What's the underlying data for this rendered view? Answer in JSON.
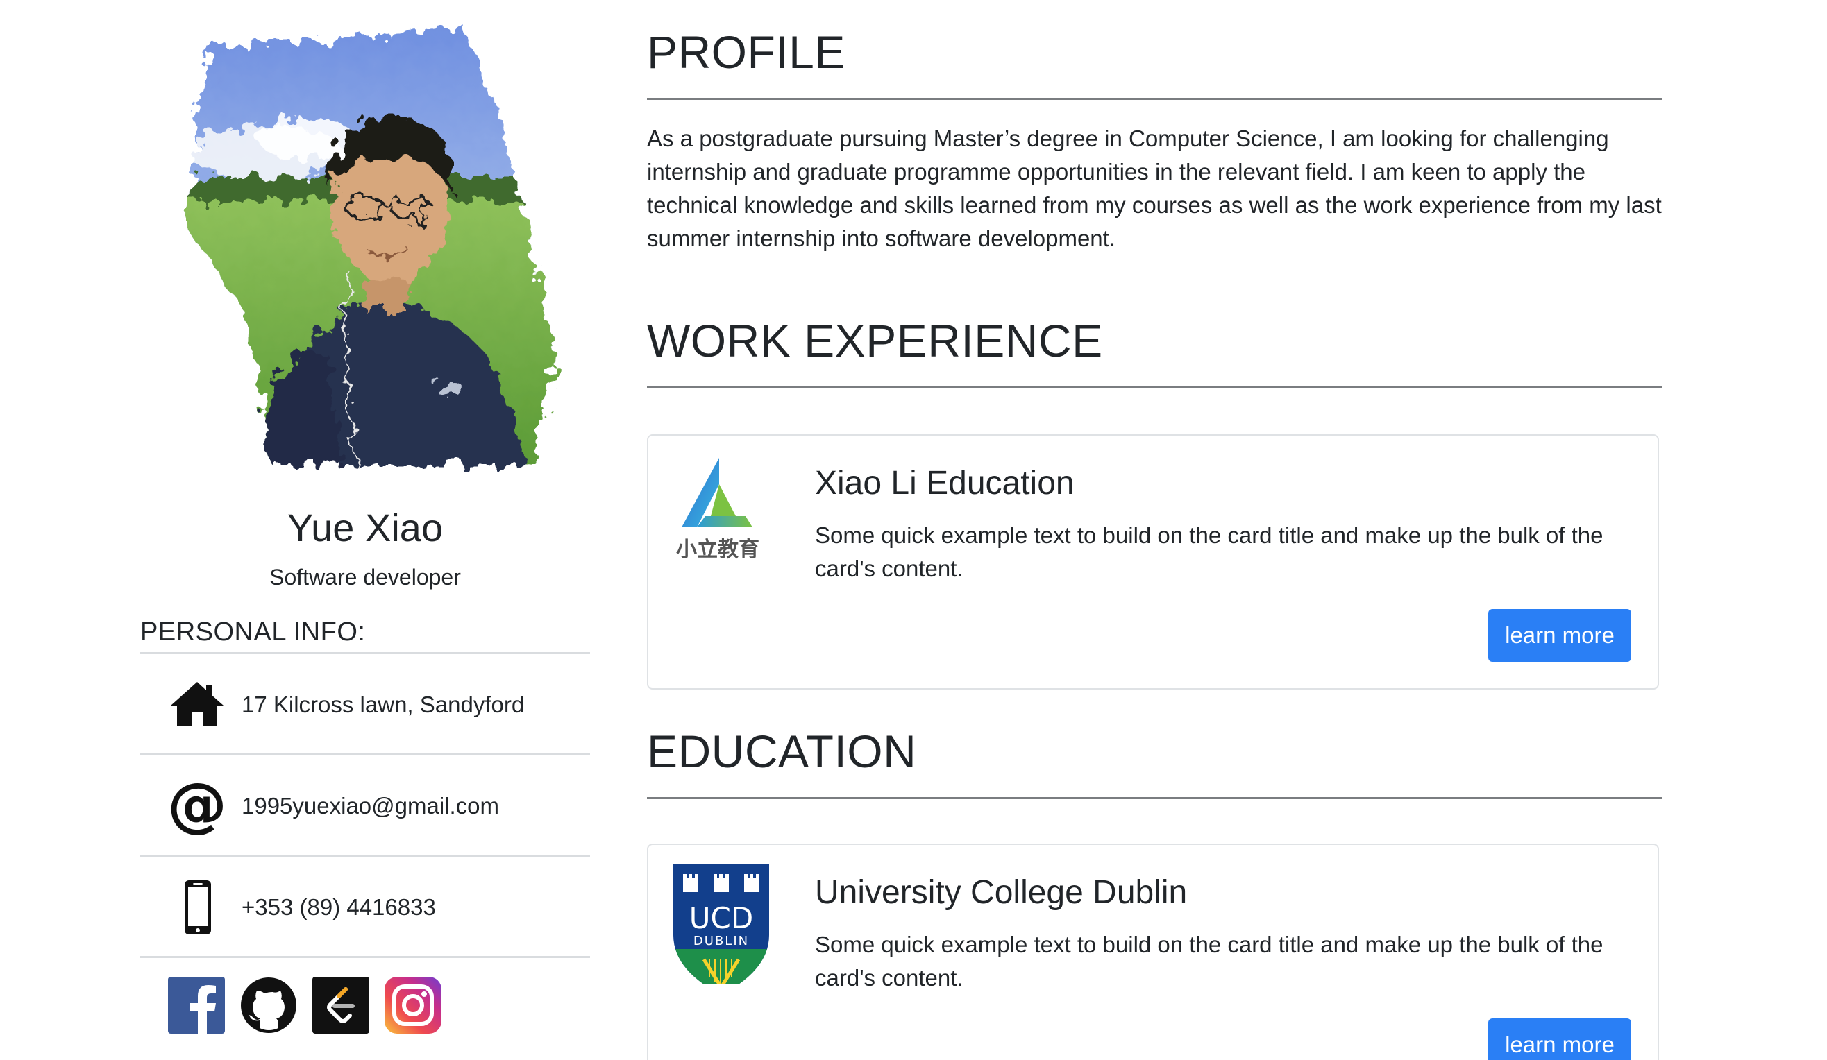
{
  "sidebar": {
    "name": "Yue Xiao",
    "role": "Software developer",
    "personal_info_heading": "PERSONAL INFO:",
    "info": [
      {
        "icon": "home-icon",
        "text": "17 Kilcross lawn, Sandyford"
      },
      {
        "icon": "at-sign-icon",
        "text": "1995yuexiao@gmail.com"
      },
      {
        "icon": "phone-icon",
        "text": "+353 (89) 4416833"
      }
    ],
    "socials": [
      "facebook-icon",
      "github-icon",
      "leetcode-icon",
      "instagram-icon"
    ]
  },
  "main": {
    "profile": {
      "heading": "PROFILE",
      "text": "As a postgraduate pursuing Master’s degree in Computer Science, I am looking for challenging internship and graduate programme opportunities in the relevant field. I am keen to apply the technical knowledge and skills learned from my courses as well as the work experience from my last summer internship into software development."
    },
    "work": {
      "heading": "WORK EXPERIENCE",
      "cards": [
        {
          "logo_text": "小立教育",
          "title": "Xiao Li Education",
          "text": "Some quick example text to build on the card title and make up the bulk of the card's content.",
          "button": "learn more"
        }
      ]
    },
    "education": {
      "heading": "EDUCATION",
      "cards": [
        {
          "logo_text_main": "UCD",
          "logo_text_sub": "DUBLIN",
          "title": "University College Dublin",
          "text": "Some quick example text to build on the card title and make up the bulk of the card's content.",
          "button": "learn more"
        }
      ]
    }
  },
  "colors": {
    "accent": "#2a7ff5",
    "text": "#212529",
    "rule": "#7a7d80"
  }
}
